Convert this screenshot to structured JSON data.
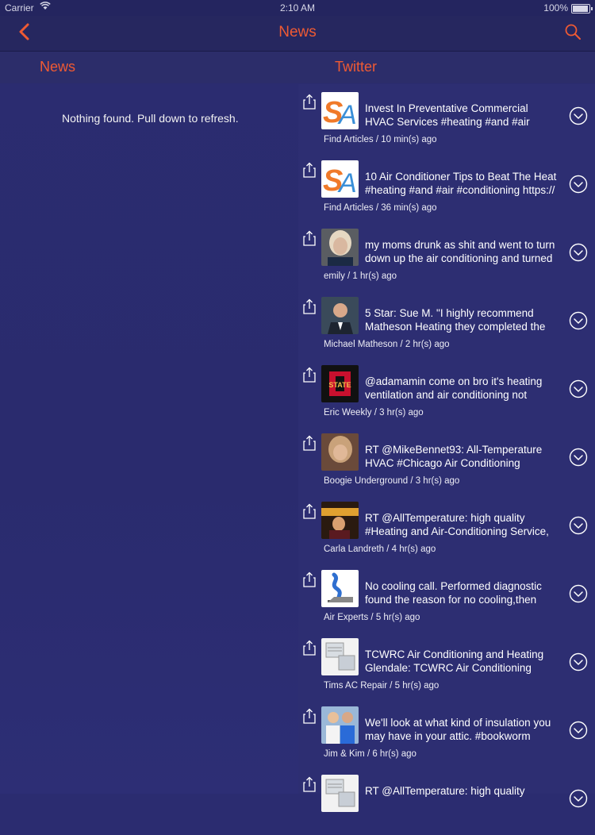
{
  "status_bar": {
    "carrier": "Carrier",
    "time": "2:10 AM",
    "battery": "100%"
  },
  "nav": {
    "title": "News",
    "back_icon": "chevron-left-icon",
    "search_icon": "search-icon"
  },
  "tabs": [
    {
      "label": "News"
    },
    {
      "label": "Twitter"
    }
  ],
  "news": {
    "empty_message": "Nothing found. Pull down to refresh."
  },
  "colors": {
    "accent": "#ef5a33",
    "background": "#2b2c70",
    "panel": "#2d2e72"
  },
  "tweets": [
    {
      "avatar": "sa-logo",
      "line1": "Invest In Preventative Commercial",
      "line2": "HVAC Services #heating #and #air",
      "meta": "Find Articles / 10 min(s) ago"
    },
    {
      "avatar": "sa-logo",
      "line1": "10 Air Conditioner Tips to Beat The Heat",
      "line2": "#heating #and #air #conditioning https://",
      "meta": "Find Articles / 36 min(s) ago"
    },
    {
      "avatar": "photo-blonde",
      "line1": "my moms drunk as shit and went to turn",
      "line2": "down up the air conditioning and turned",
      "meta": "emily / 1 hr(s) ago"
    },
    {
      "avatar": "photo-man-suit",
      "line1": "5 Star: Sue M. \"I highly recommend",
      "line2": " Matheson Heating  they completed the",
      "meta": "Michael Matheson / 2 hr(s) ago"
    },
    {
      "avatar": "state-logo",
      "line1": "@adamamin come on bro it's heating",
      "line2": "ventilation and air conditioning not",
      "meta": "Eric Weekly / 3 hr(s) ago"
    },
    {
      "avatar": "photo-woman",
      "line1": "RT @MikeBennet93: All-Temperature",
      "line2": "HVAC #Chicago Air Conditioning",
      "meta": "Boogie Underground / 3 hr(s) ago"
    },
    {
      "avatar": "photo-dark",
      "line1": "RT @AllTemperature: high quality",
      "line2": "#Heating and Air-Conditioning Service,",
      "meta": "Carla Landreth / 4 hr(s) ago"
    },
    {
      "avatar": "air-experts-logo",
      "line1": "No cooling call. Performed diagnostic",
      "line2": "found the reason for no cooling,then",
      "meta": "Air Experts / 5 hr(s) ago"
    },
    {
      "avatar": "ac-unit-photo",
      "line1": "TCWRC Air Conditioning and Heating",
      "line2": "Glendale: TCWRC Air Conditioning",
      "meta": "Tims AC Repair / 5 hr(s) ago"
    },
    {
      "avatar": "photo-couple",
      "line1": "We'll look at what kind of insulation you",
      "line2": "may have in your attic. #bookworm",
      "meta": "Jim & Kim / 6 hr(s) ago"
    },
    {
      "avatar": "ac-unit-photo",
      "line1": "RT @AllTemperature: high quality",
      "line2": "",
      "meta": ""
    }
  ]
}
